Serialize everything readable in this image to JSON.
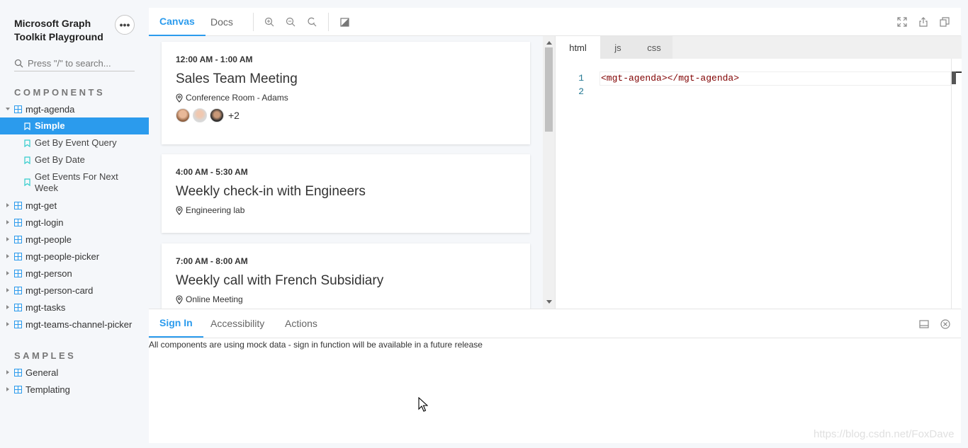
{
  "app": {
    "title": "Microsoft Graph Toolkit Playground",
    "more_label": "•••",
    "search_placeholder": "Press \"/\" to search..."
  },
  "sidebar": {
    "components_label": "COMPONENTS",
    "samples_label": "SAMPLES",
    "components": [
      {
        "label": "mgt-agenda",
        "expanded": true
      },
      {
        "label": "mgt-get"
      },
      {
        "label": "mgt-login"
      },
      {
        "label": "mgt-people"
      },
      {
        "label": "mgt-people-picker"
      },
      {
        "label": "mgt-person"
      },
      {
        "label": "mgt-person-card"
      },
      {
        "label": "mgt-tasks"
      },
      {
        "label": "mgt-teams-channel-picker"
      }
    ],
    "agenda_children": [
      {
        "label": "Simple",
        "active": true
      },
      {
        "label": "Get By Event Query"
      },
      {
        "label": "Get By Date"
      },
      {
        "label": "Get Events For Next Week"
      }
    ],
    "samples": [
      {
        "label": "General"
      },
      {
        "label": "Templating"
      }
    ]
  },
  "toolbar": {
    "tabs": [
      {
        "label": "Canvas",
        "active": true
      },
      {
        "label": "Docs"
      }
    ],
    "icons": [
      "zoom-in-icon",
      "zoom-out-icon",
      "reset-zoom-icon",
      "theme-toggle-icon",
      "fullscreen-icon",
      "share-icon",
      "copy-icon"
    ]
  },
  "agenda": {
    "events": [
      {
        "time": "12:00 AM - 1:00 AM",
        "subject": "Sales Team Meeting",
        "location": "Conference Room - Adams",
        "extra_attendees": "+2"
      },
      {
        "time": "4:00 AM - 5:30 AM",
        "subject": "Weekly check-in with Engineers",
        "location": "Engineering lab"
      },
      {
        "time": "7:00 AM - 8:00 AM",
        "subject": "Weekly call with French Subsidiary",
        "location": "Online Meeting"
      }
    ]
  },
  "editor": {
    "tabs": [
      {
        "label": "html",
        "active": true
      },
      {
        "label": "js"
      },
      {
        "label": "css"
      }
    ],
    "lines": [
      {
        "num": "1",
        "code": "<mgt-agenda></mgt-agenda>"
      },
      {
        "num": "2",
        "code": ""
      }
    ]
  },
  "bottom_panel": {
    "tabs": [
      {
        "label": "Sign In",
        "active": true
      },
      {
        "label": "Accessibility"
      },
      {
        "label": "Actions"
      }
    ],
    "message": "All components are using mock data - sign in function will be available in a future release"
  },
  "watermark": "https://blog.csdn.net/FoxDave",
  "colors": {
    "accent": "#2b9bed",
    "background": "#f5f7fa"
  }
}
